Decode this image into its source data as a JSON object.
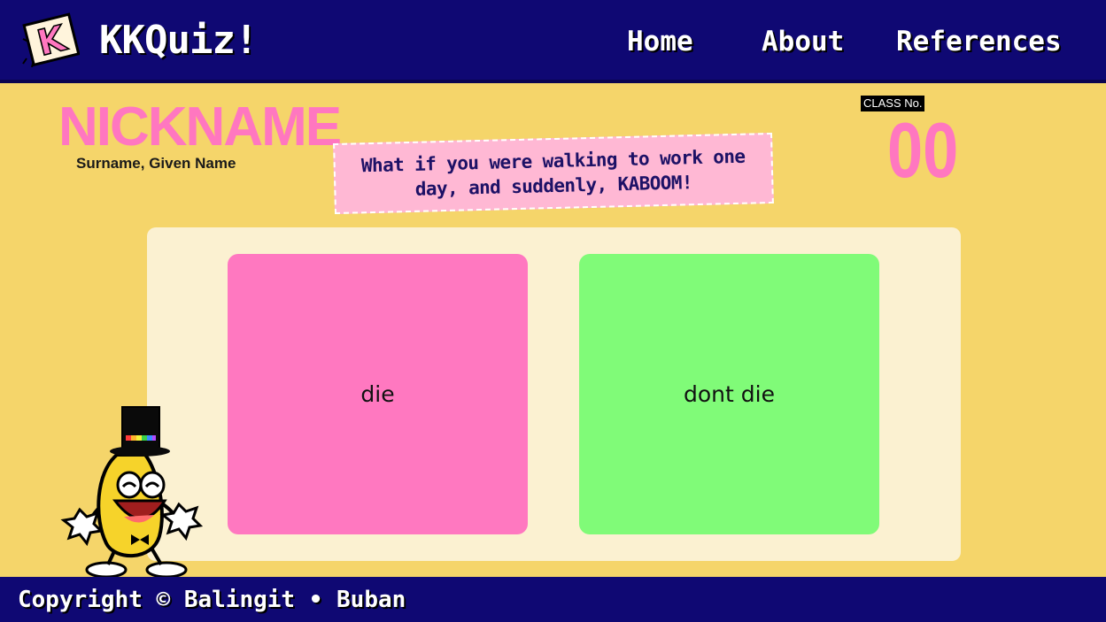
{
  "header": {
    "logo_letter": "K",
    "brand": "KKQuiz!",
    "nav": {
      "home": "Home",
      "about": "About",
      "references": "References"
    }
  },
  "player": {
    "nickname": "NICKNAME",
    "fullname": "Surname, Given Name",
    "class_label": "CLASS No.",
    "class_number": "00"
  },
  "question": {
    "text": "What if you were walking to work one day, and suddenly, KABOOM!"
  },
  "answers": [
    {
      "label": "die",
      "color": "#ff78c0"
    },
    {
      "label": "dont die",
      "color": "#80fb78"
    }
  ],
  "mascot": {
    "icon": "dancing-banana-icon",
    "hat_band": "rainbow"
  },
  "footer": {
    "copyright": "Copyright © Balingit • Buban"
  },
  "colors": {
    "navy": "#0f0873",
    "background": "#f5d56a",
    "panel": "#fbf1d1",
    "pink": "#ff77c0",
    "question_bg": "#ffb8d4",
    "green": "#80fb78"
  }
}
